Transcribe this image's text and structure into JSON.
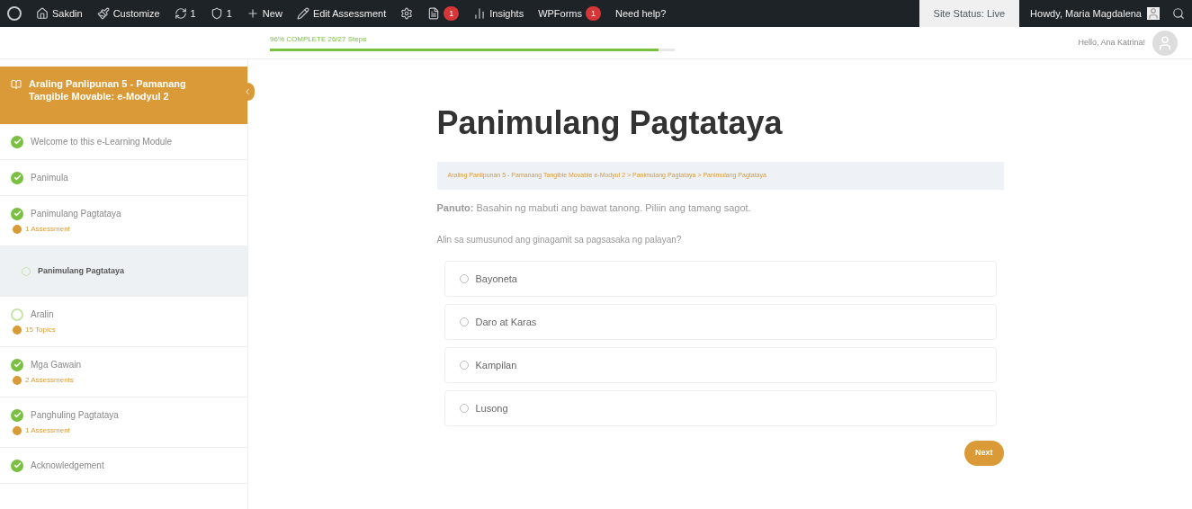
{
  "admin_bar": {
    "items": [
      {
        "kind": "wp"
      },
      {
        "kind": "home",
        "label": "Sakdin"
      },
      {
        "kind": "brush",
        "label": "Customize"
      },
      {
        "kind": "sync",
        "label": "1"
      },
      {
        "kind": "shield",
        "label": "1"
      },
      {
        "kind": "plus",
        "label": "New"
      },
      {
        "kind": "pencil",
        "label": "Edit Assessment"
      },
      {
        "kind": "gear"
      },
      {
        "kind": "doc",
        "badge": "1"
      },
      {
        "kind": "chart",
        "label": "Insights"
      },
      {
        "kind": "text",
        "label": "WPForms",
        "badge": "1"
      },
      {
        "kind": "text",
        "label": "Need help?"
      }
    ],
    "site_status": "Site Status: Live",
    "greeting": "Howdy, Maria Magdalena"
  },
  "progress": {
    "label": "96% COMPLETE 26/27 Steps",
    "level": 0.96
  },
  "user_greeting": "Hello, Ana Katrina!",
  "sidebar": {
    "title": "Araling Panlipunan 5 - Pamanang Tangible Movable: e-Modyul 2",
    "items": [
      {
        "label": "Welcome to this e-Learning Module",
        "complete": true
      },
      {
        "label": "Panimula",
        "complete": true
      },
      {
        "label": "Panimulang Pagtataya",
        "complete": true,
        "meta": "1 Assessment",
        "children": [
          {
            "label": "Panimulang Pagtataya",
            "selected": true
          }
        ]
      },
      {
        "label": "Aralin",
        "complete": false,
        "meta": "15 Topics"
      },
      {
        "label": "Mga Gawain",
        "complete": true,
        "meta": "2 Assessments"
      },
      {
        "label": "Panghuling Pagtataya",
        "complete": true,
        "meta": "1 Assessment"
      },
      {
        "label": "Acknowledgement",
        "complete": true
      }
    ]
  },
  "content": {
    "title": "Panimulang Pagtataya",
    "breadcrumb": "Araling Panlipunan 5 - Pamanang Tangible Movable e-Modyul 2 > Panimulang Pagtataya > Panimulang Pagtataya",
    "instruction": "**Panuto:** Basahin ng mabuti ang bawat tanong. Piliin ang tamang sagot.",
    "question": "Alin sa sumusunod ang ginagamit sa pagsasaka ng palayan?",
    "options": [
      {
        "label": "Bayoneta",
        "selected": false
      },
      {
        "label": "Daro at Karas",
        "selected": false
      },
      {
        "label": "Kampilan",
        "selected": false
      },
      {
        "label": "Lusong",
        "selected": false
      }
    ],
    "next_button": "Next"
  }
}
